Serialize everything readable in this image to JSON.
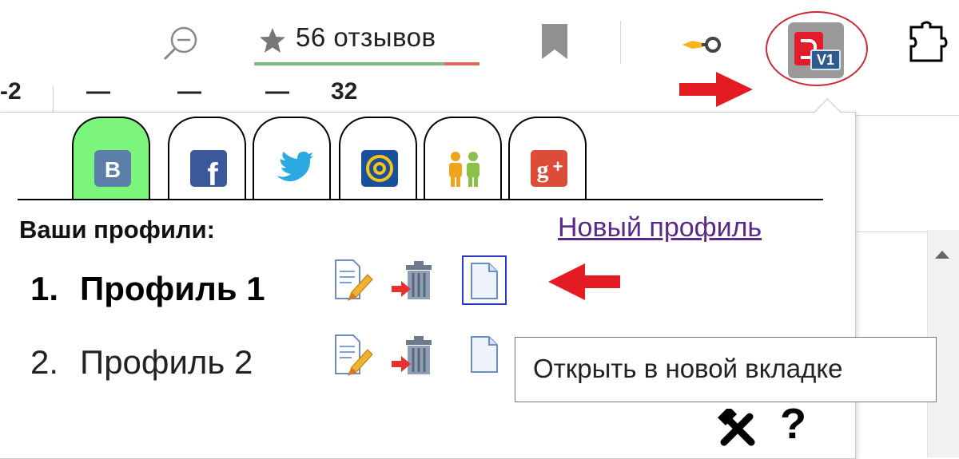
{
  "toolbar": {
    "rating_text": "56 отзывов",
    "icons": [
      "zoom-out-icon",
      "star-icon",
      "bookmark-icon",
      "key-icon",
      "extension-icon",
      "puzzle-icon"
    ],
    "extension_badge": "V1"
  },
  "background_page": {
    "fragments": [
      "-2",
      "—",
      "—",
      "—",
      "32"
    ]
  },
  "popup": {
    "tabs": [
      {
        "id": "vk",
        "icon": "vk-icon",
        "glyph": "B",
        "color": "#5b7fa6",
        "active": true
      },
      {
        "id": "facebook",
        "icon": "facebook-icon",
        "glyph": "f",
        "color": "#3b5998",
        "active": false
      },
      {
        "id": "twitter",
        "icon": "twitter-icon",
        "glyph": "",
        "color": "#2ba9e1",
        "active": false
      },
      {
        "id": "mail",
        "icon": "mail-ru-icon",
        "glyph": "@",
        "color": "#1a4f9c",
        "active": false
      },
      {
        "id": "odnoklassniki",
        "icon": "people-icon",
        "glyph": "",
        "color": "#f0a31c",
        "active": false
      },
      {
        "id": "google-plus",
        "icon": "google-plus-icon",
        "glyph": "g+",
        "color": "#dd4b39",
        "active": false
      }
    ],
    "profiles_label": "Ваши профили:",
    "new_profile_link": "Новый профиль",
    "profiles": [
      {
        "number": "1.",
        "name": "Профиль 1",
        "bold": true
      },
      {
        "number": "2.",
        "name": "Профиль 2",
        "bold": false
      }
    ],
    "tooltip": "Открыть в новой вкладке",
    "help": "?"
  },
  "colors": {
    "active_tab": "#7cf57c",
    "highlight_red": "#cc2a36",
    "link": "#5a2a8a",
    "focus_blue": "#2a39c8"
  }
}
